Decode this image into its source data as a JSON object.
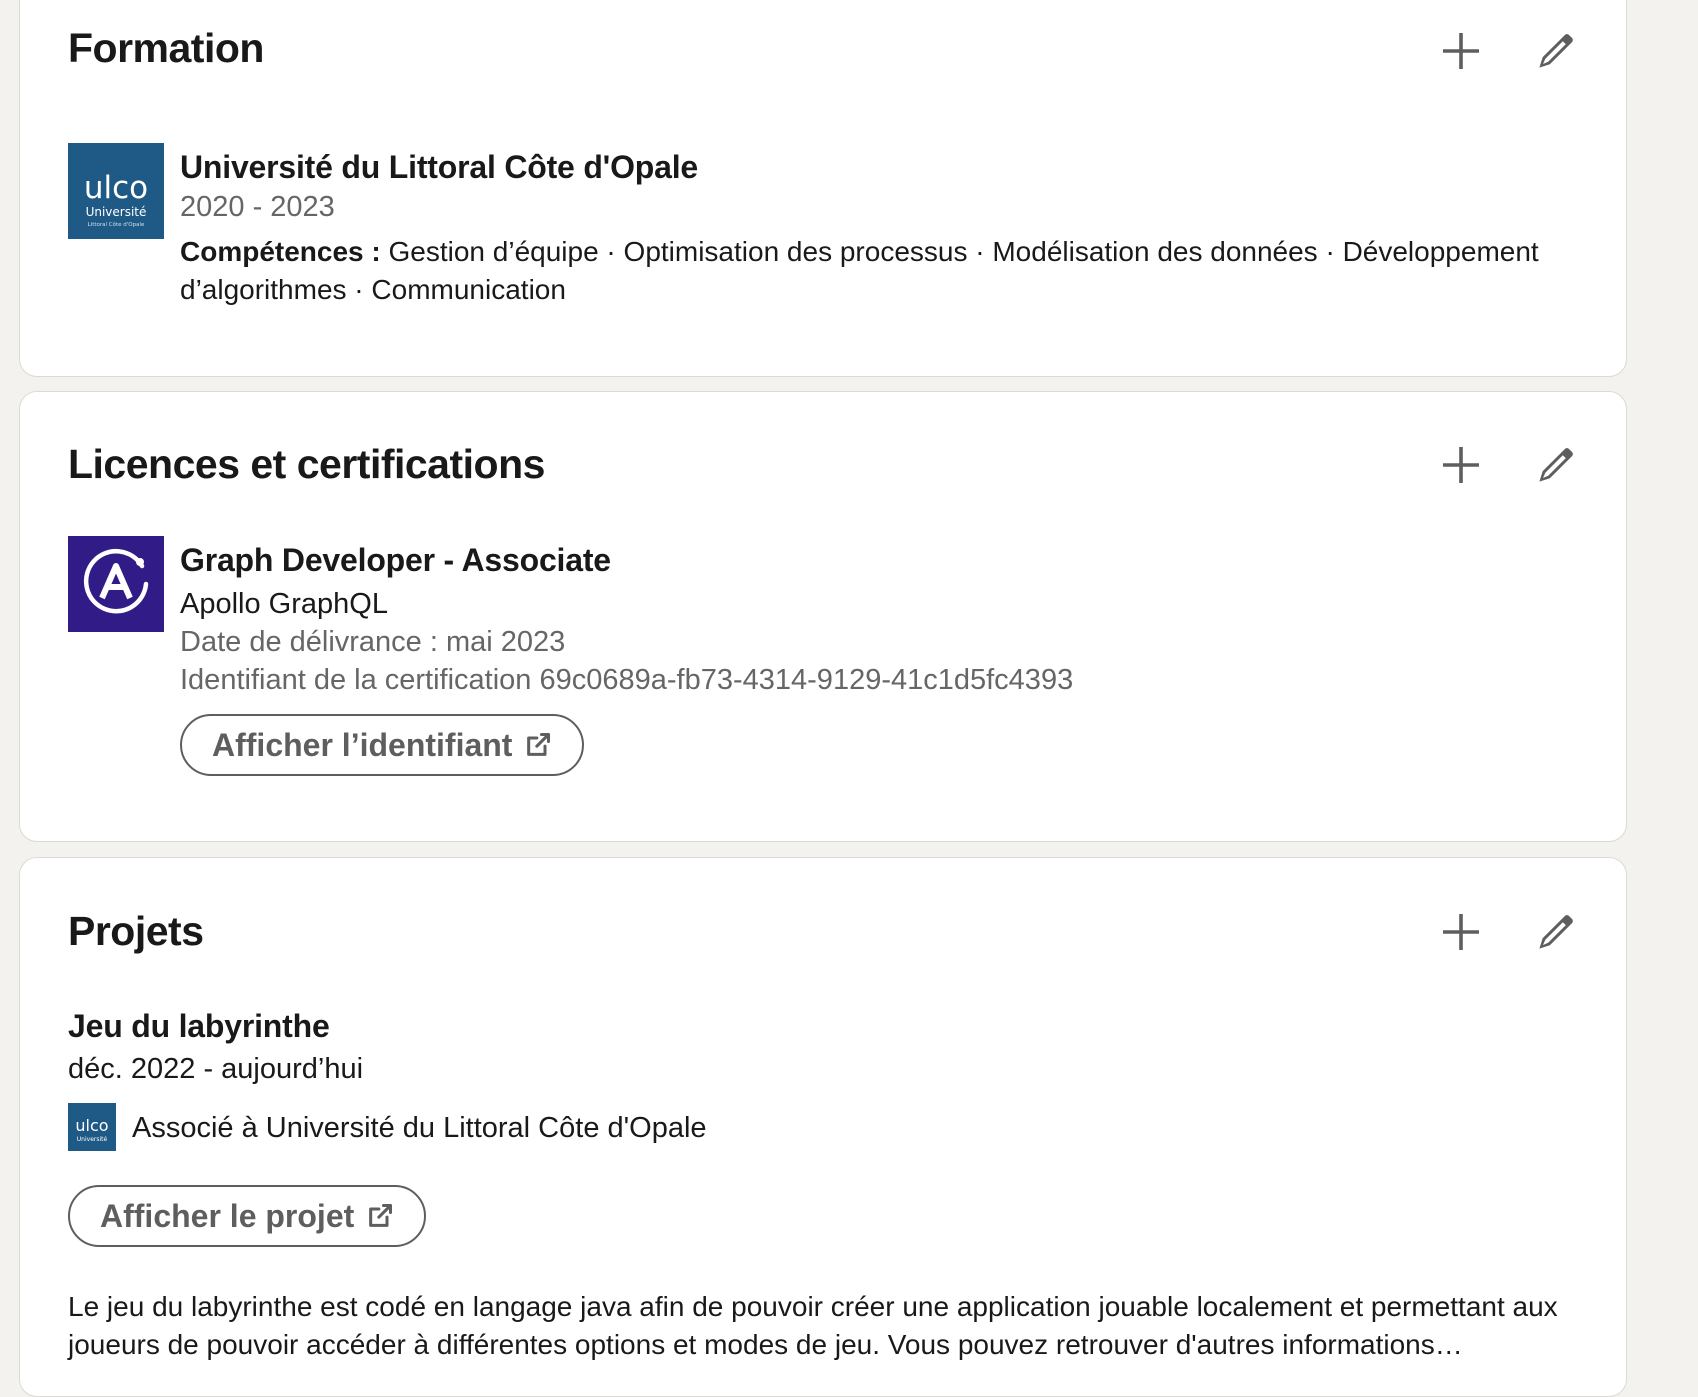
{
  "formation": {
    "title": "Formation",
    "entry": {
      "school": "Université du Littoral Côte d'Opale",
      "logo_text": "ulco",
      "logo_subtext": "Université",
      "logo_caption": "Littoral Côte d'Opale",
      "dates": "2020 - 2023",
      "skills_label": "Compétences :",
      "skills_text": "Gestion d’équipe · Optimisation des processus · Modélisation des données · Développement d’algorithmes · Communication"
    },
    "add_icon": "plus-icon",
    "edit_icon": "pencil-icon"
  },
  "licences": {
    "title": "Licences et certifications",
    "entry": {
      "name": "Graph Developer - Associate",
      "issuer": "Apollo GraphQL",
      "issued": "Date de délivrance : mai 2023",
      "credential_id": "Identifiant de la certification 69c0689a-fb73-4314-9129-41c1d5fc4393",
      "button_label": "Afficher l’identifiant"
    },
    "add_icon": "plus-icon",
    "edit_icon": "pencil-icon"
  },
  "projets": {
    "title": "Projets",
    "entry": {
      "name": "Jeu du labyrinthe",
      "dates": "déc. 2022 - aujourd’hui",
      "associated": "Associé à Université du Littoral Côte d'Opale",
      "button_label": "Afficher le projet",
      "description": "Le jeu du labyrinthe est codé en langage java afin de pouvoir créer une application jouable localement et permettant aux joueurs de pouvoir accéder à différentes options et modes de jeu. Vous pouvez retrouver d'autres informations…"
    },
    "add_icon": "plus-icon",
    "edit_icon": "pencil-icon"
  },
  "colors": {
    "page_bg": "#f4f2ee",
    "card_bg": "#ffffff",
    "ulco_blue": "#1f5a86",
    "apollo_purple": "#311c87",
    "muted_text": "#666666"
  }
}
